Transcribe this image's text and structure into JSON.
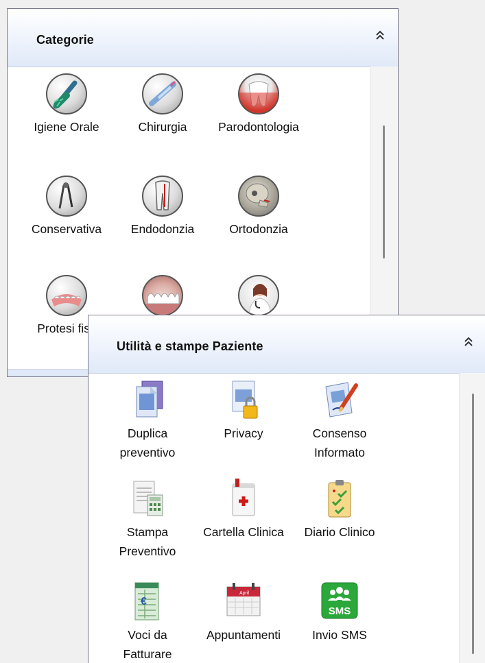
{
  "categories": {
    "title": "Categorie",
    "items": [
      {
        "label": "Igiene Orale",
        "icon": "toothbrush-icon"
      },
      {
        "label": "Chirurgia",
        "icon": "syringe-icon"
      },
      {
        "label": "Parodontologia",
        "icon": "tooth-gum-icon"
      },
      {
        "label": "Conservativa",
        "icon": "dental-drill-icon"
      },
      {
        "label": "Endodonzia",
        "icon": "root-canal-icon"
      },
      {
        "label": "Ortodonzia",
        "icon": "skull-xray-icon"
      },
      {
        "label": "Protesi fiss",
        "icon": "denture-icon"
      },
      {
        "label": "",
        "icon": "bridge-icon"
      },
      {
        "label": "",
        "icon": "doctor-icon"
      }
    ]
  },
  "utilities": {
    "title": "Utilità e stampe Paziente",
    "items": [
      {
        "label_lines": [
          "Duplica",
          "preventivo"
        ],
        "icon": "duplicate-docs-icon"
      },
      {
        "label_lines": [
          "Privacy"
        ],
        "icon": "lock-document-icon"
      },
      {
        "label_lines": [
          "Consenso",
          "Informato"
        ],
        "icon": "signed-document-icon"
      },
      {
        "label_lines": [
          "Stampa",
          "Preventivo"
        ],
        "icon": "calculator-document-icon"
      },
      {
        "label_lines": [
          "Cartella Clinica"
        ],
        "icon": "medical-folder-icon"
      },
      {
        "label_lines": [
          "Diario Clinico"
        ],
        "icon": "checklist-clipboard-icon"
      },
      {
        "label_lines": [
          "Voci da",
          "Fatturare"
        ],
        "icon": "invoice-icon"
      },
      {
        "label_lines": [
          "Appuntamenti"
        ],
        "icon": "calendar-icon"
      },
      {
        "label_lines": [
          "Invio SMS"
        ],
        "icon": "sms-icon"
      }
    ],
    "sms_badge": "SMS",
    "calendar_month": "April"
  }
}
